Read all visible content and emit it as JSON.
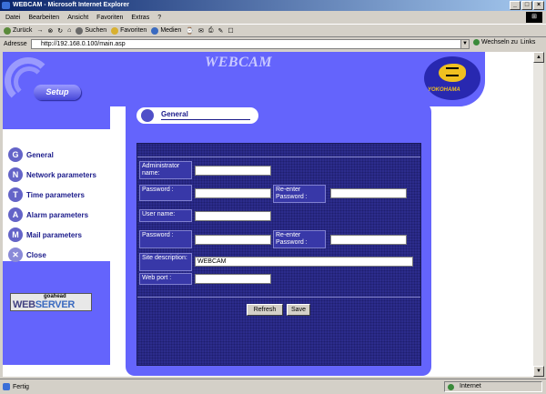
{
  "window": {
    "title": "WEBCAM - Microsoft Internet Explorer",
    "min": "_",
    "max": "□",
    "close": "×"
  },
  "menu": [
    "Datei",
    "Bearbeiten",
    "Ansicht",
    "Favoriten",
    "Extras",
    "?"
  ],
  "toolbar": {
    "back": "Zurück",
    "forward": "→",
    "stop": "⊗",
    "refresh": "↻",
    "home": "⌂",
    "search": "Suchen",
    "favorites": "Favoriten",
    "media": "Medien",
    "history": "⌚",
    "mail": "✉",
    "print": "⎙",
    "edit": "✎",
    "discuss": "☐"
  },
  "address": {
    "label": "Adresse",
    "url": "http://192.168.0.100/main.asp",
    "go": "Wechseln zu",
    "links": "Links"
  },
  "status": {
    "text": "Fertig",
    "zone": "Internet"
  },
  "page": {
    "title": "WEBCAM",
    "setup_label": "Setup",
    "brand": "YOKOHAMA",
    "section_title": "General",
    "nav": [
      {
        "label": "General",
        "icon": "G"
      },
      {
        "label": "Network parameters",
        "icon": "N"
      },
      {
        "label": "Time parameters",
        "icon": "T"
      },
      {
        "label": "Alarm parameters",
        "icon": "A"
      },
      {
        "label": "Mail parameters",
        "icon": "M"
      },
      {
        "label": "Close",
        "icon": "✕"
      }
    ],
    "goahead": {
      "top": "goahead",
      "web": "WEB",
      "server": "SERVER"
    },
    "form": {
      "admin_label": "Administrator name:",
      "admin_value": "",
      "password_label": "Password :",
      "password_value": "",
      "reenter_label": "Re-enter Password :",
      "reenter_value": "",
      "username_label": "User name:",
      "username_value": "",
      "user_password_label": "Password :",
      "user_password_value": "",
      "user_reenter_label": "Re-enter Password :",
      "user_reenter_value": "",
      "site_label": "Site description:",
      "site_value": "WEBCAM",
      "port_label": "Web port :",
      "port_value": "",
      "refresh_button": "Refresh",
      "save_button": "Save"
    }
  }
}
